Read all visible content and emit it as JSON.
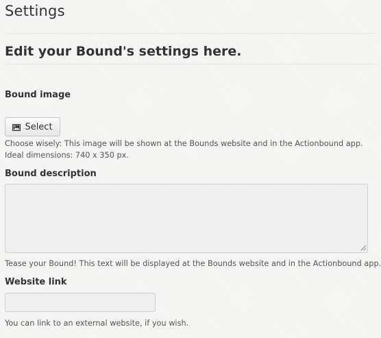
{
  "page": {
    "title": "Settings",
    "section_heading": "Edit your Bound's settings here."
  },
  "bound_image": {
    "label": "Bound image",
    "button_label": "Select",
    "button_icon": "picture-icon",
    "help_line_1": "Choose wisely: This image will be shown at the Bounds website and in the Actionbound app.",
    "help_line_2": "Ideal dimensions: 740 x 350 px."
  },
  "bound_description": {
    "label": "Bound description",
    "value": "",
    "help": "Tease your Bound! This text will be displayed at the Bounds website and in the Actionbound app."
  },
  "website_link": {
    "label": "Website link",
    "value": "",
    "help": "You can link to an external website, if you wish."
  }
}
